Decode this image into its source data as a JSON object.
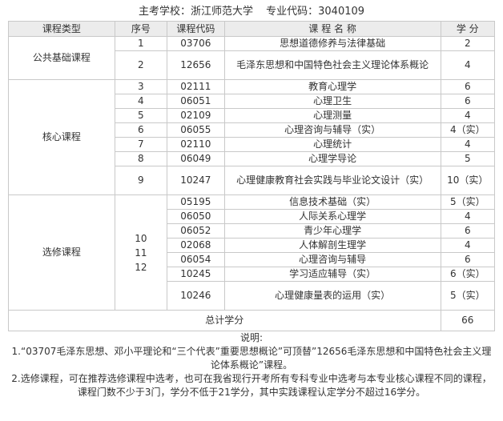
{
  "header": {
    "school": "主考学校：浙江师范大学",
    "code": "专业代码：3040109"
  },
  "columns": {
    "type": "课程类型",
    "seq": "序号",
    "code": "课程代码",
    "name": "课 程 名 称",
    "credit": "学 分"
  },
  "groups": {
    "public": {
      "label": "公共基础课程",
      "rows": [
        {
          "seq": "1",
          "code": "03706",
          "name": "思想道德修养与法律基础",
          "credit": "2"
        },
        {
          "seq": "2",
          "code": "12656",
          "name": "毛泽东思想和中国特色社会主义理论体系概论",
          "credit": "4"
        }
      ]
    },
    "core": {
      "label": "核心课程",
      "rows": [
        {
          "seq": "3",
          "code": "02111",
          "name": "教育心理学",
          "credit": "6"
        },
        {
          "seq": "4",
          "code": "06051",
          "name": "心理卫生",
          "credit": "6"
        },
        {
          "seq": "5",
          "code": "02109",
          "name": "心理测量",
          "credit": "4"
        },
        {
          "seq": "6",
          "code": "06055",
          "name": "心理咨询与辅导（实）",
          "credit": "4（实）"
        },
        {
          "seq": "7",
          "code": "02110",
          "name": "心理统计",
          "credit": "4"
        },
        {
          "seq": "8",
          "code": "06049",
          "name": "心理学导论",
          "credit": "5"
        },
        {
          "seq": "9",
          "code": "10247",
          "name": "心理健康教育社会实践与毕业论文设计（实）",
          "credit": "10（实）"
        }
      ]
    },
    "elective": {
      "label": "选修课程",
      "seqs": [
        "10",
        "11",
        "12"
      ],
      "rows": [
        {
          "code": "05195",
          "name": "信息技术基础（实）",
          "credit": "5（实）"
        },
        {
          "code": "06050",
          "name": "人际关系心理学",
          "credit": "4"
        },
        {
          "code": "06052",
          "name": "青少年心理学",
          "credit": "6"
        },
        {
          "code": "02068",
          "name": "人体解剖生理学",
          "credit": "4"
        },
        {
          "code": "06054",
          "name": "心理咨询与辅导",
          "credit": "6"
        },
        {
          "code": "10245",
          "name": "学习适应辅导（实）",
          "credit": "6（实）"
        },
        {
          "code": "10246",
          "name": "心理健康量表的运用（实）",
          "credit": "5（实）"
        }
      ]
    }
  },
  "total": {
    "label": "总计学分",
    "value": "66"
  },
  "notes": {
    "title": "说明:",
    "items": [
      "1.“03707毛泽东思想、邓小平理论和“三个代表”重要思想概论”可顶替”12656毛泽东思想和中国特色社会主义理论体系概论”课程。",
      "2.选修课程，可在推荐选修课程中选考，也可在我省现行开考所有专科专业中选考与本专业核心课程不同的课程，课程门数不少于3门，学分不低于21学分，其中实践课程认定学分不超过16学分。"
    ]
  }
}
